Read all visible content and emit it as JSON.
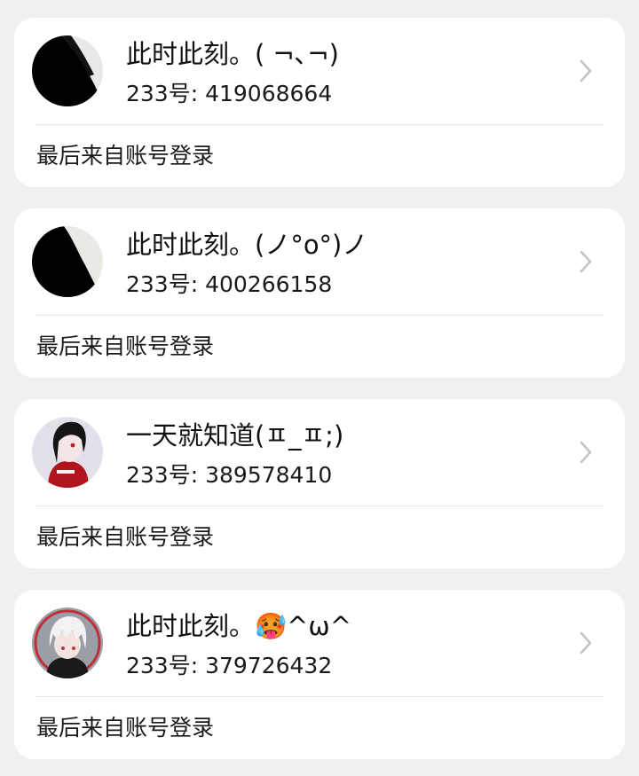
{
  "accounts": [
    {
      "nickname": "此时此刻。( ¬､¬)",
      "uid_text": "233号: 419068664",
      "login_note": "最后来自账号登录",
      "avatar_icon": "black-white-split-avatar"
    },
    {
      "nickname": "此时此刻。(ノ°ο°)ノ",
      "uid_text": "233号: 400266158",
      "login_note": "最后来自账号登录",
      "avatar_icon": "black-white-split-avatar"
    },
    {
      "nickname": "一天就知道(ㅍ_ㅍ;)",
      "uid_text": "233号: 389578410",
      "login_note": "最后来自账号登录",
      "avatar_icon": "anime-character-red-hoodie-avatar"
    },
    {
      "nickname": "此时此刻。🥵^ω^",
      "uid_text": "233号: 379726432",
      "login_note": "最后来自账号登录",
      "avatar_icon": "anime-character-white-hair-avatar"
    }
  ],
  "colors": {
    "background": "#f0f0f0",
    "card": "#ffffff",
    "chevron": "#c4c4c4",
    "divider": "#e6e6e6"
  }
}
